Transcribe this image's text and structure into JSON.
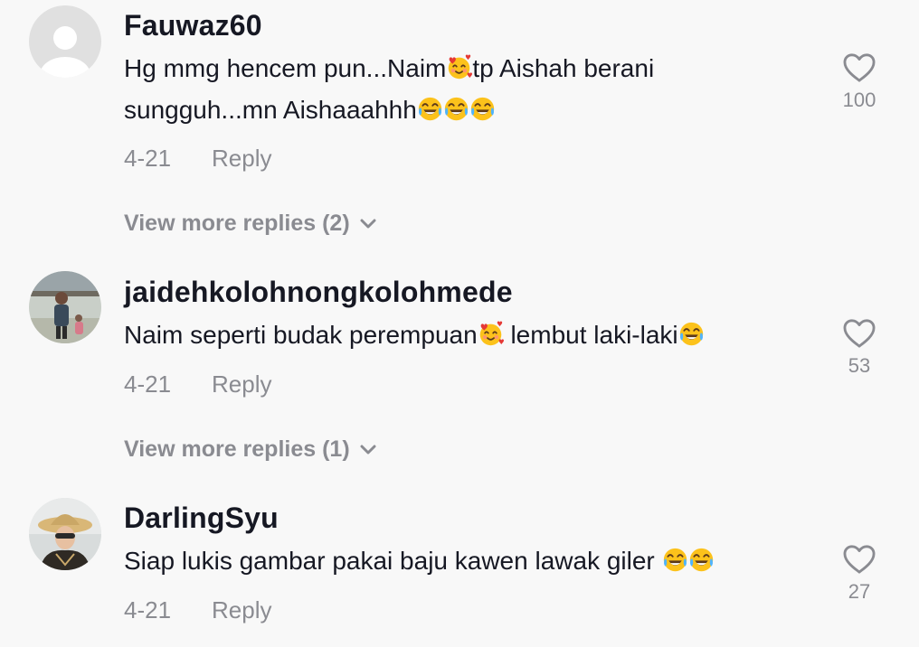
{
  "comments": [
    {
      "username": "Fauwaz60",
      "text_segments": [
        "Hg mmg hencem pun...Naim",
        "tp Aishah berani sungguh...mn Aishaaahhh"
      ],
      "date": "4-21",
      "reply_label": "Reply",
      "likes": "100",
      "view_more": "View more replies (2)"
    },
    {
      "username": "jaidehkolohnongkolohmede",
      "text_segments": [
        "Naim seperti budak perempuan",
        " lembut laki-laki"
      ],
      "date": "4-21",
      "reply_label": "Reply",
      "likes": "53",
      "view_more": "View more replies (1)"
    },
    {
      "username": "DarlingSyu",
      "text_segments": [
        "Siap lukis gambar pakai baju kawen lawak giler "
      ],
      "date": "4-21",
      "reply_label": "Reply",
      "likes": "27"
    }
  ],
  "icons": {
    "like": "heart-outline-icon",
    "expand": "chevron-down-icon",
    "emoji_love": "smiling-face-with-hearts-emoji",
    "emoji_laugh": "face-with-tears-of-joy-emoji"
  },
  "colors": {
    "background": "#f8f8f8",
    "text_primary": "#161823",
    "text_secondary": "#8a8b91"
  }
}
